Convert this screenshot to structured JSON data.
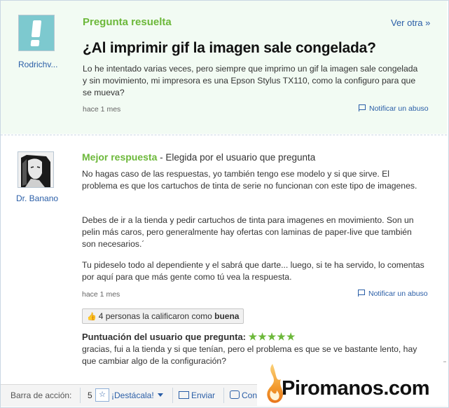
{
  "question": {
    "user": "Rodrichv...",
    "status": "Pregunta resuelta",
    "nav_link": "Ver otra »",
    "title": "¿Al imprimir gif la imagen sale congelada?",
    "body": "Lo he intentado varias veces, pero siempre que imprimo un gif la imagen sale congelada y sin movimiento, mi impresora es una Epson Stylus TX110, como la configuro para que se mueva?",
    "time": "hace 1 mes",
    "report": "Notificar un abuso"
  },
  "answer": {
    "user": "Dr. Banano",
    "label_strong": "Mejor respuesta",
    "label_rest": " - Elegida por el usuario que pregunta",
    "paragraphs": [
      "No hagas caso de las respuestas, yo también tengo ese modelo y si que sirve. El problema es que los cartuchos de tinta de serie no funcionan con este tipo de imagenes.",
      "Debes de ir a la tienda y pedir cartuchos de tinta para imagenes en movimiento. Son un pelin más caros, pero generalmente hay ofertas con laminas de paper-live que también son necesarios.´",
      "Tu pideselo todo al dependiente y el sabrá que darte... luego, si te ha servido, lo comentas por aquí para que más gente como tú vea la respuesta."
    ],
    "time": "hace 1 mes",
    "report": "Notificar un abuso",
    "rating_text": "4 personas la calificaron como ",
    "rating_word": "buena",
    "score_label": "Puntuación del usuario que pregunta:",
    "score_stars": "★★★★★",
    "comment": "gracias, fui a la tienda y si que tenían, pero el problema es que se ve bastante lento, hay que cambiar algo de la configuración?"
  },
  "action_bar": {
    "label": "Barra de acción:",
    "count": "5",
    "destacala": "¡Destácala!",
    "enviar": "Enviar",
    "comentar": "Con"
  },
  "watermark": {
    "text": "Piromanos.com"
  },
  "colors": {
    "link": "#2a5ea7",
    "green": "#6cb83a",
    "question_bg": "#f2fbf3"
  }
}
